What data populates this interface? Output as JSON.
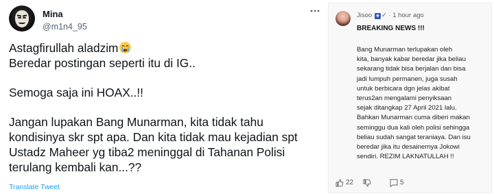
{
  "tweet": {
    "display_name": "Mina",
    "handle": "@m1n4_95",
    "more_icon": "ellipsis-icon",
    "lines_p1": [
      "Astagfirullah aladzim",
      "Beredar postingan seperti itu di IG.."
    ],
    "emoji": "loudly-crying-face",
    "lines_p2": [
      "Semoga saja ini HOAX..!!"
    ],
    "lines_p3": [
      "Jangan lupakan Bang Munarman, kita tidak tahu",
      "kondisinya skr spt apa.  Dan kita tidak mau kejadian spt",
      "Ustadz Maheer yg tiba2 meninggal di Tahanan Polisi",
      "terulang kembali kan...??"
    ],
    "translate_label": "Translate Tweet",
    "link_color": "#1d9bf0"
  },
  "comment": {
    "author": "Jisoo",
    "badge": "✓",
    "meta": "· 1 hour ago",
    "headline": "BREAKING NEWS !!!",
    "body_lines": [
      "Bang Munarman terlupakan oleh",
      "kita, banyak kabar beredar jika beliau",
      "sekarang tidak bisa berjalan dan bisa",
      "jadi lumpuh permanen, juga susah",
      "untuk berbicara dgn jelas akibat",
      "terus2an mengalami penyiksaan",
      "sejak ditangkap 27 April 2021 lalu.",
      "Bahkan Munarman cuma diberi makan",
      "seminggu dua kali oleh polisi sehingga",
      "beliau sudah sangat teraniaya. Dan isu",
      "beredar jika itu desainernya Jokowi",
      "sendiri. REZIM LAKNATULLAH !!"
    ],
    "like_count": "22",
    "reply_count": "5",
    "icons": [
      "thumbs-up-icon",
      "thumbs-down-icon",
      "comment-icon"
    ]
  }
}
